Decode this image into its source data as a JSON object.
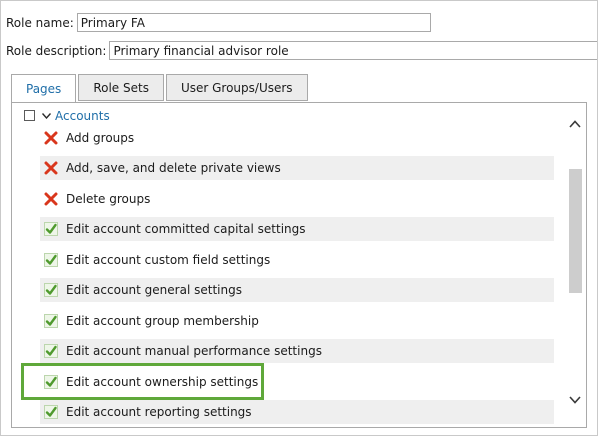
{
  "role": {
    "name_label": "Role name:",
    "name_value": "Primary FA",
    "description_label": "Role description:",
    "description_value": "Primary financial advisor role"
  },
  "tabs": [
    {
      "label": "Pages",
      "active": true
    },
    {
      "label": "Role Sets",
      "active": false
    },
    {
      "label": "User Groups/Users",
      "active": false
    }
  ],
  "group": {
    "label": "Accounts",
    "checked": false,
    "expanded": true
  },
  "permissions": [
    {
      "label": "Add groups",
      "state": "denied",
      "icon": "red-x-icon"
    },
    {
      "label": "Add, save, and delete private views",
      "state": "denied",
      "icon": "red-x-icon"
    },
    {
      "label": "Delete groups",
      "state": "denied",
      "icon": "red-x-icon"
    },
    {
      "label": "Edit account committed capital settings",
      "state": "granted",
      "icon": "green-check-icon"
    },
    {
      "label": "Edit account custom field settings",
      "state": "granted",
      "icon": "green-check-icon"
    },
    {
      "label": "Edit account general settings",
      "state": "granted",
      "icon": "green-check-icon"
    },
    {
      "label": "Edit account group membership",
      "state": "granted",
      "icon": "green-check-icon"
    },
    {
      "label": "Edit account manual performance settings",
      "state": "granted",
      "icon": "green-check-icon"
    },
    {
      "label": "Edit account ownership settings",
      "state": "granted",
      "icon": "green-check-icon"
    },
    {
      "label": "Edit account reporting settings",
      "state": "granted",
      "icon": "green-check-icon"
    }
  ],
  "highlighted_item": "Edit account ownership settings",
  "colors": {
    "accent": "#1f6ea8",
    "highlight": "#5fa83a",
    "deny": "#d9361c",
    "grant": "#4f9a2e"
  }
}
